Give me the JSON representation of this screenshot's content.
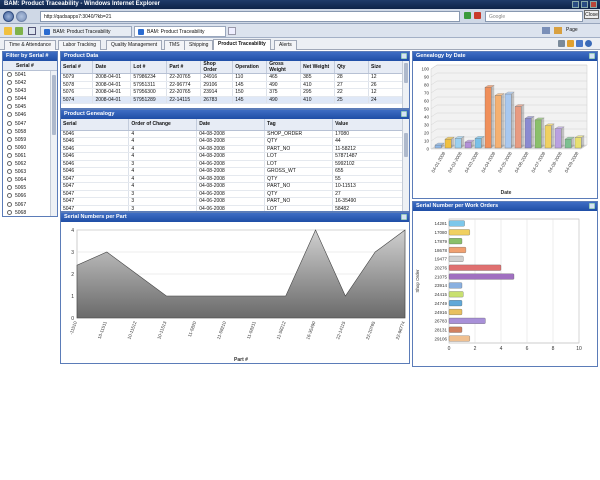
{
  "window": {
    "title": "BAM: Product Traceability - Windows Internet Explorer"
  },
  "browser": {
    "url": "http://qadsapps7:3040/?kb=21",
    "search_placeholder": "Google",
    "close_label": "Close",
    "tabs": [
      {
        "label": "BAM: Product Traceability"
      },
      {
        "label": "BAM: Product Traceability"
      }
    ],
    "page_menu": "Page"
  },
  "app_tabs": [
    {
      "label": "Time & Attendance"
    },
    {
      "label": "Labor Tracking"
    },
    {
      "label": "Quality Management"
    },
    {
      "label": "TMS"
    },
    {
      "label": "Shipping"
    },
    {
      "label": "Product Traceability"
    },
    {
      "label": "Alerts"
    }
  ],
  "filter": {
    "title": "Filter by Serial #",
    "column": "Serial #",
    "items": [
      "5041",
      "5042",
      "5043",
      "5044",
      "5045",
      "5046",
      "5047",
      "5058",
      "5059",
      "5060",
      "5061",
      "5062",
      "5063",
      "5064",
      "5065",
      "5066",
      "5067",
      "5068",
      "5069"
    ]
  },
  "product_data": {
    "title": "Product Data",
    "columns": [
      "Serial #",
      "Date",
      "Lot #",
      "Part #",
      "Shop Order",
      "Operation",
      "Gross Weight",
      "Net Weight",
      "Qty",
      "Size"
    ],
    "rows": [
      [
        "5079",
        "2008-04-01",
        "57986234",
        "22-20765",
        "24916",
        "110",
        "465",
        "385",
        "28",
        "12"
      ],
      [
        "5078",
        "2008-04-01",
        "57951311",
        "22-96774",
        "29106",
        "145",
        "490",
        "410",
        "27",
        "26"
      ],
      [
        "5076",
        "2008-04-01",
        "57956300",
        "22-20765",
        "23914",
        "150",
        "375",
        "295",
        "22",
        "12"
      ],
      [
        "5074",
        "2008-04-01",
        "57951289",
        "22-14115",
        "26783",
        "145",
        "490",
        "410",
        "25",
        "24"
      ]
    ]
  },
  "product_genealogy": {
    "title": "Product Genealogy",
    "columns": [
      "Serial",
      "Order of Change",
      "Date",
      "Tag",
      "Value"
    ],
    "rows": [
      [
        "5046",
        "4",
        "04-08-2008",
        "SHOP_ORDER",
        "17080"
      ],
      [
        "5046",
        "4",
        "04-08-2008",
        "QTY",
        "44"
      ],
      [
        "5046",
        "4",
        "04-08-2008",
        "PART_NO",
        "11-58212"
      ],
      [
        "5046",
        "4",
        "04-08-2008",
        "LOT",
        "57871487"
      ],
      [
        "5046",
        "3",
        "04-06-2008",
        "LOT",
        "5992102"
      ],
      [
        "5046",
        "4",
        "04-08-2008",
        "GROSS_WT",
        "655"
      ],
      [
        "5047",
        "4",
        "04-08-2008",
        "QTY",
        "55"
      ],
      [
        "5047",
        "4",
        "04-08-2008",
        "PART_NO",
        "10-11513"
      ],
      [
        "5047",
        "3",
        "04-06-2008",
        "QTY",
        "27"
      ],
      [
        "5047",
        "3",
        "04-06-2008",
        "PART_NO",
        "16-35490"
      ],
      [
        "5047",
        "3",
        "04-06-2008",
        "LOT",
        "58482"
      ],
      [
        "5047",
        "3",
        "04-06-2008",
        "SHOP_ORDER",
        ""
      ]
    ]
  },
  "charts": [
    {
      "panel_title": "Genealogy by Date",
      "chart_data": {
        "type": "bar",
        "title": "",
        "xlabel": "Date",
        "ylabel": "",
        "ylim": [
          0,
          100
        ],
        "yticks": [
          0,
          10,
          20,
          30,
          40,
          50,
          60,
          70,
          80,
          90,
          100
        ],
        "grid": true,
        "legend": "none",
        "categories": [
          "04-01-2008",
          "04-02-2008",
          "04-03-2008",
          "04-04-2008",
          "04-05-2008",
          "04-06-2008",
          "04-07-2008",
          "04-08-2008",
          "04-09-2008"
        ],
        "values": [
          4,
          12,
          13,
          8,
          13,
          82,
          71,
          73,
          56,
          40,
          38,
          30,
          26,
          12,
          14
        ],
        "colors": [
          "#8fb8e8",
          "#f0c040",
          "#9bd0f0",
          "#b28fd8",
          "#78c0e8",
          "#f08f5a",
          "#f5b070",
          "#a8c8f0",
          "#e89a80",
          "#8a8ad0",
          "#8ac06a",
          "#f0d060",
          "#b9a0e0",
          "#7cc090",
          "#e8e070"
        ]
      }
    },
    {
      "panel_title": "Serial Numbers per Part",
      "chart_data": {
        "type": "area",
        "title": "",
        "xlabel": "Part #",
        "ylabel": "",
        "ylim": [
          0,
          4
        ],
        "yticks": [
          0,
          1,
          2,
          3,
          4
        ],
        "grid": true,
        "legend": "none",
        "categories": [
          "-11510",
          "10-11511",
          "10-11512",
          "10-11513",
          "11-5820",
          "11-58210",
          "11-58211",
          "11-58212",
          "16-35490",
          "22-14115",
          "22-20765",
          "22-96774"
        ],
        "values": [
          2.4,
          3.0,
          2.0,
          1.0,
          1.0,
          1.0,
          1.0,
          1.0,
          4.0,
          1.0,
          3.0,
          4.0
        ]
      }
    },
    {
      "panel_title": "Serial Number per Work Orders",
      "chart_data": {
        "type": "bar",
        "orientation": "horizontal",
        "title": "",
        "xlabel": "",
        "ylabel": "Shop Order",
        "xlim": [
          0,
          10
        ],
        "xticks": [
          0,
          2,
          4,
          6,
          8,
          10
        ],
        "grid": true,
        "legend": "none",
        "categories": [
          "14281",
          "17080",
          "17879",
          "18678",
          "19477",
          "20276",
          "21075",
          "23914",
          "24415",
          "24749",
          "24916",
          "26783",
          "28131",
          "29106"
        ],
        "values": [
          1.2,
          1.6,
          1.0,
          1.3,
          1.1,
          4.0,
          5.0,
          1.0,
          1.1,
          1.0,
          1.0,
          2.8,
          1.0,
          1.6
        ],
        "colors": [
          "#7cc7ea",
          "#f0d060",
          "#8ac06a",
          "#f0a070",
          "#d0d0d0",
          "#e07070",
          "#a070c0",
          "#8ab0e0",
          "#c8e070",
          "#60a8d8",
          "#e8c060",
          "#a890d8",
          "#d08060",
          "#f0c090"
        ]
      }
    }
  ]
}
